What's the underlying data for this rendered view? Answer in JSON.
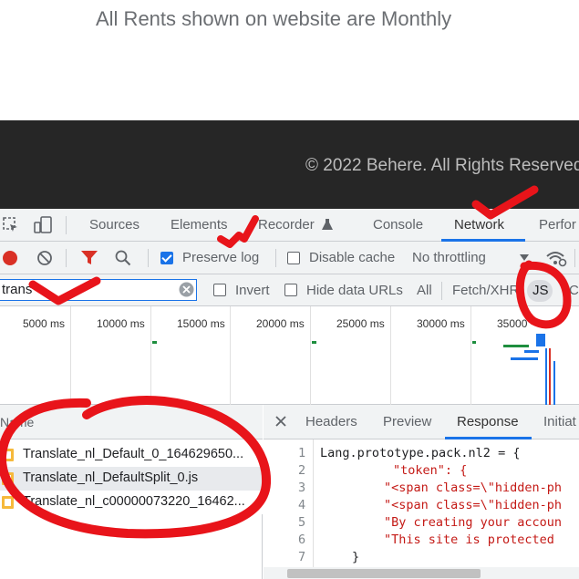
{
  "page": {
    "notice": "All Rents shown on website are Monthly",
    "footer": "© 2022 Behere. All Rights Reserved"
  },
  "devtools": {
    "tabs": [
      "Sources",
      "Elements",
      "Recorder",
      "Console",
      "Network",
      "Perfor"
    ],
    "active_tab": "Network",
    "toolbar": {
      "preserve_log": "Preserve log",
      "preserve_log_checked": true,
      "disable_cache": "Disable cache",
      "disable_cache_checked": false,
      "throttling": "No throttling"
    },
    "filter": {
      "value": "trans",
      "invert": "Invert",
      "hide_data_urls": "Hide data URLs",
      "types": [
        "All",
        "Fetch/XHR",
        "JS",
        "CSS"
      ],
      "active_type": "JS"
    },
    "timeline": {
      "ticks": [
        "5000 ms",
        "10000 ms",
        "15000 ms",
        "20000 ms",
        "25000 ms",
        "30000 ms",
        "35000"
      ]
    },
    "requests": {
      "column_header": "Name",
      "items": [
        "Translate_nl_Default_0_164629650...",
        "Translate_nl_DefaultSplit_0.js",
        "Translate_nl_c00000073220_16462..."
      ],
      "selected_index": 1
    },
    "detail": {
      "tabs": [
        "Headers",
        "Preview",
        "Response",
        "Initiat"
      ],
      "active_tab": "Response",
      "line_numbers": [
        "1",
        "2",
        "3",
        "4",
        "5",
        "6",
        "7"
      ],
      "lines": [
        "Lang.prototype.pack.nl2 = {",
        "\"token\": {",
        "\"<span class=\\\"hidden-ph",
        "\"<span class=\\\"hidden-ph",
        "\"By creating your accoun",
        "\"This site is protected",
        "}"
      ]
    }
  },
  "colors": {
    "accent": "#1a73e8",
    "annotation": "#e8141a",
    "footer_bg": "#262626"
  }
}
